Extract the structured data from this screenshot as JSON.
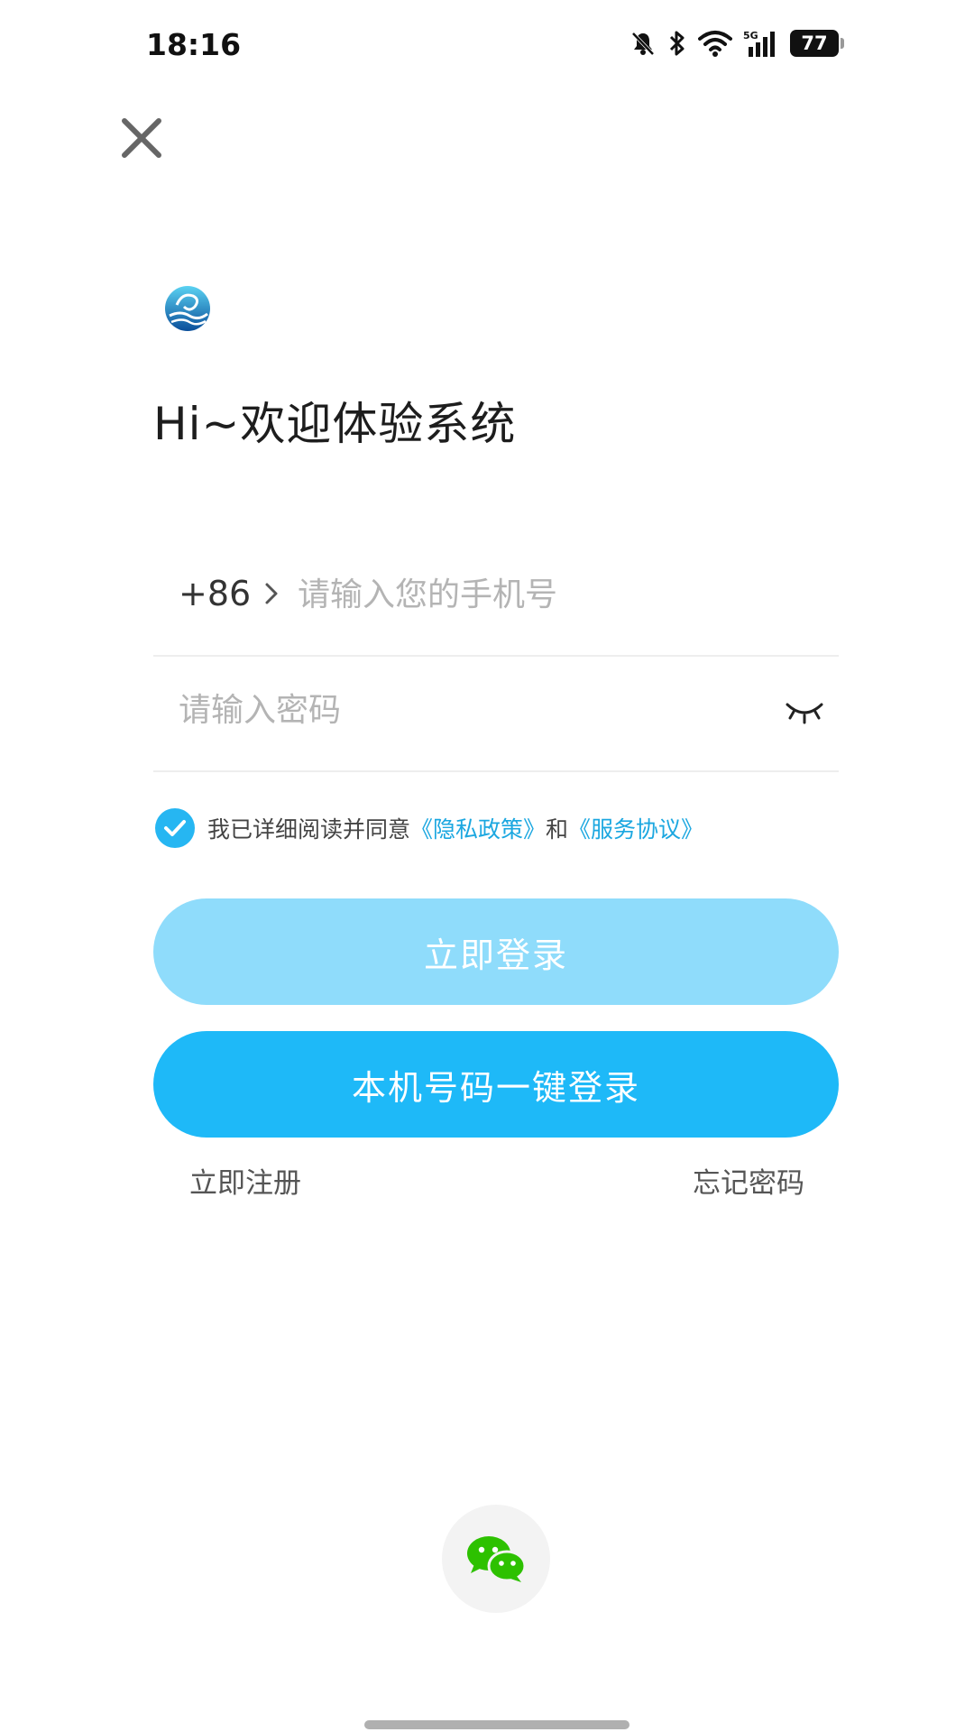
{
  "status_bar": {
    "time": "18:16",
    "battery": "77",
    "network": "5G"
  },
  "header": {
    "close_icon": "close-icon",
    "welcome": "Hi~欢迎体验系统"
  },
  "form": {
    "country_code": "+86",
    "phone_placeholder": "请输入您的手机号",
    "password_placeholder": "请输入密码",
    "eye_icon": "eye-closed-icon"
  },
  "agreement": {
    "checked": true,
    "prefix": "我已详细阅读并同意",
    "privacy_link": "《隐私政策》",
    "and": "和",
    "service_link": "《服务协议》"
  },
  "buttons": {
    "login": "立即登录",
    "one_key_login": "本机号码一键登录",
    "register": "立即注册",
    "forgot_password": "忘记密码"
  },
  "social": {
    "wechat_icon": "wechat-icon"
  },
  "colors": {
    "accent": "#1eb9f8",
    "accent_light": "#8fdcfb",
    "link": "#1ba7e0",
    "wechat": "#2dc100"
  }
}
